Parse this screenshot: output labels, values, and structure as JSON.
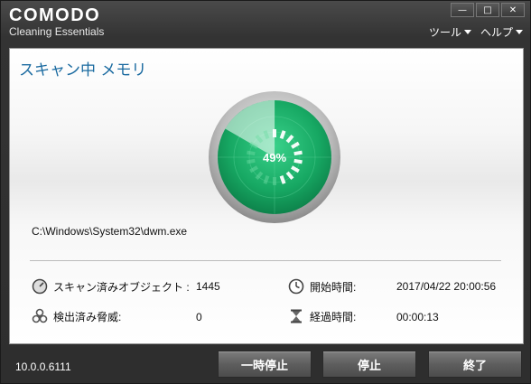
{
  "app": {
    "logo": "COMODO",
    "subtitle": "Cleaning Essentials"
  },
  "window_controls": {
    "minimize": "—",
    "maximize": "□",
    "close": "✕"
  },
  "menu": {
    "tools": "ツール",
    "help": "ヘルプ"
  },
  "scan": {
    "title": "スキャン中 メモリ",
    "progress_label": "49%",
    "progress_value": 49,
    "current_file": "C:\\Windows\\System32\\dwm.exe"
  },
  "stats": {
    "scanned_label": "スキャン済みオブジェクト :",
    "scanned_value": "1445",
    "detected_label": "検出済み脅威:",
    "detected_value": "0",
    "start_label": "開始時間:",
    "start_value": "2017/04/22 20:00:56",
    "elapsed_label": "経過時間:",
    "elapsed_value": "00:00:13"
  },
  "footer": {
    "version": "10.0.0.6111",
    "pause": "一時停止",
    "stop": "停止",
    "exit": "終了"
  },
  "colors": {
    "accent_blue": "#1a6aa0",
    "gauge_green": "#1fae6a"
  }
}
